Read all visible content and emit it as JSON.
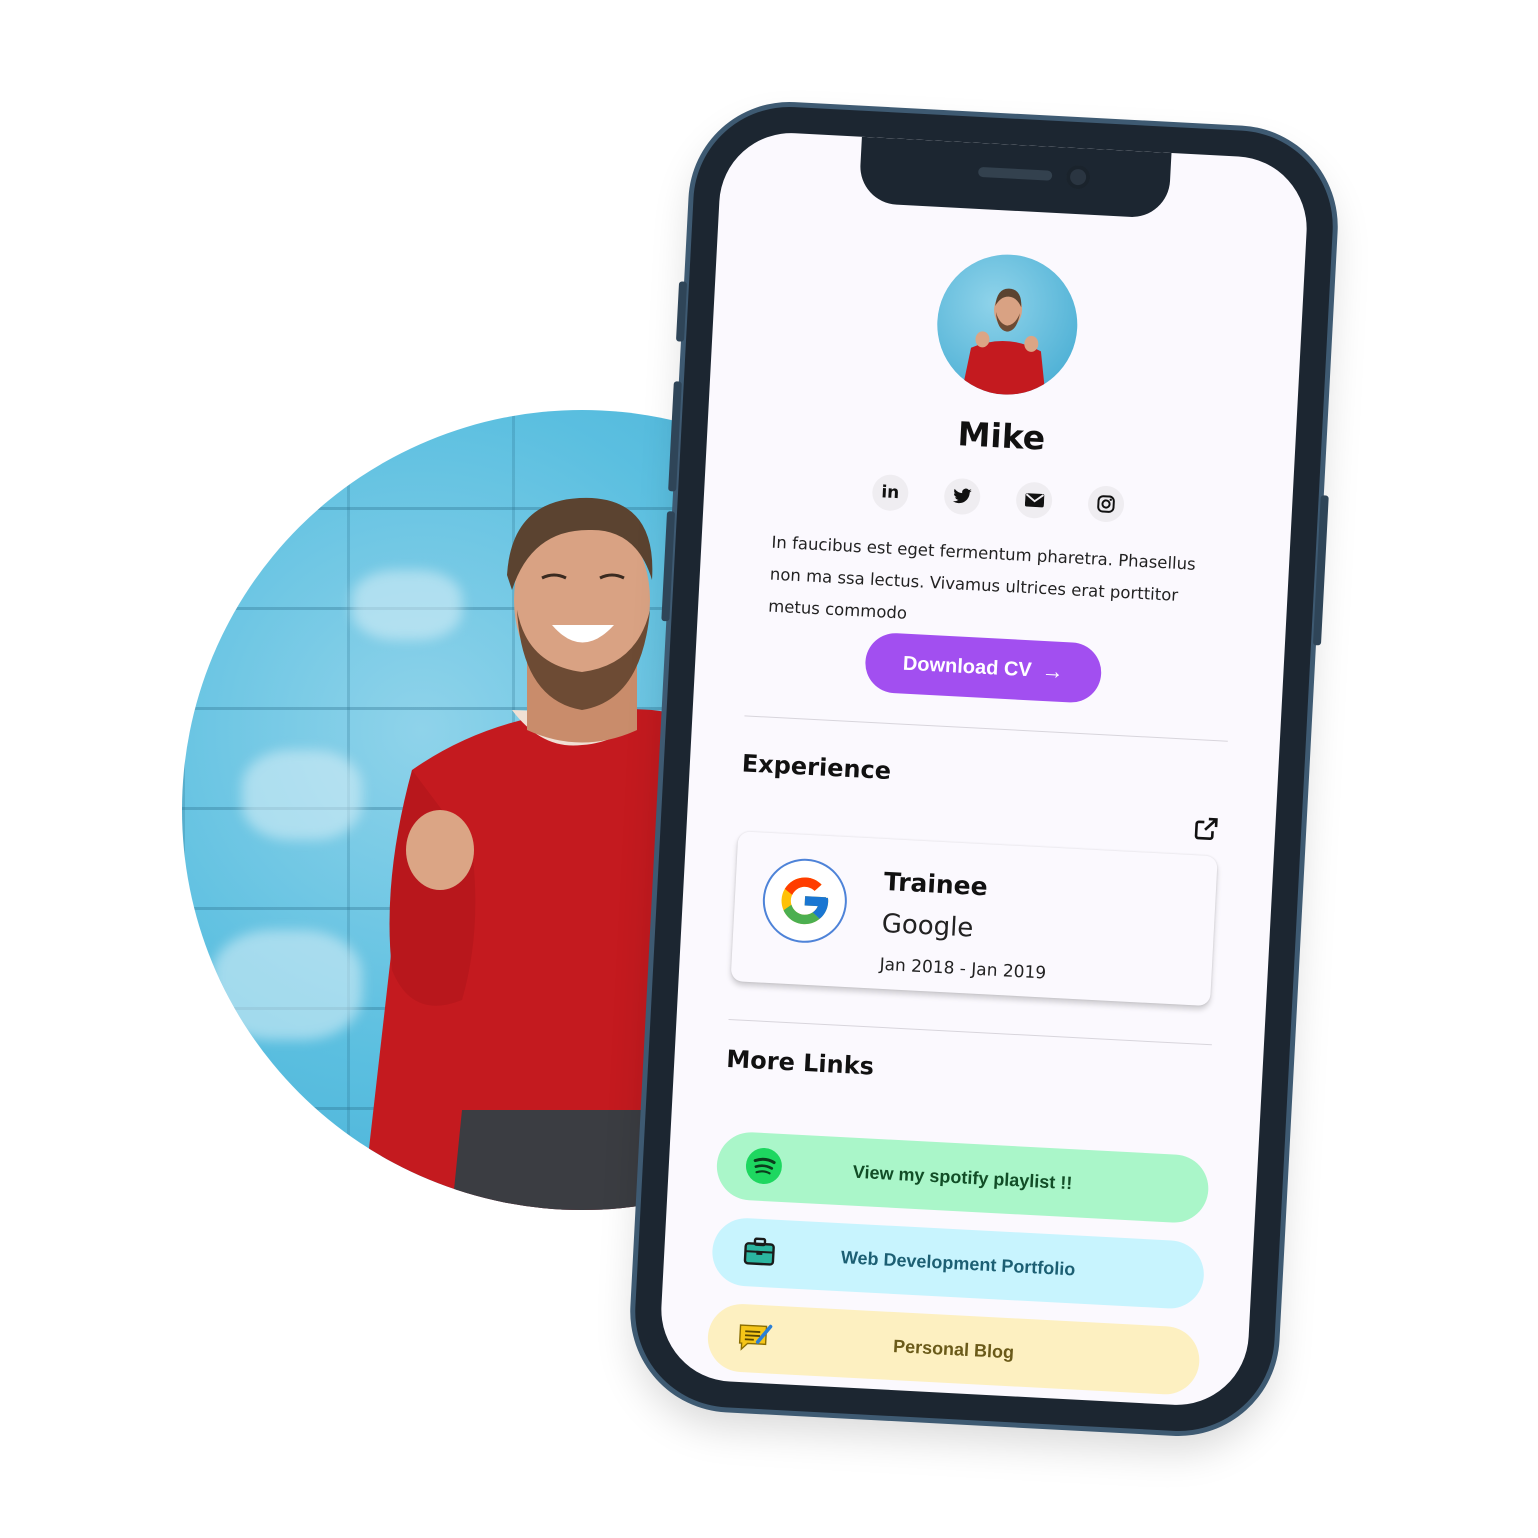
{
  "profile": {
    "name": "Mike",
    "bio": "In faucibus est eget fermentum pharetra. Phasellus non ma ssa lectus. Vivamus ultrices erat porttitor metus commodo"
  },
  "socials": [
    {
      "icon": "linkedin-icon",
      "glyph": "in"
    },
    {
      "icon": "twitter-icon",
      "glyph": ""
    },
    {
      "icon": "mail-icon",
      "glyph": ""
    },
    {
      "icon": "instagram-icon",
      "glyph": ""
    }
  ],
  "cta": {
    "label": "Download CV",
    "arrow": "→"
  },
  "experience": {
    "title": "Experience",
    "items": [
      {
        "role": "Trainee",
        "company": "Google",
        "period": "Jan 2018 - Jan 2019",
        "logo": "google-logo-icon"
      }
    ]
  },
  "more_links": {
    "title": "More Links",
    "items": [
      {
        "label": "View my spotify playlist !!",
        "icon": "spotify-icon",
        "color": "#aaf6c9"
      },
      {
        "label": "Web Development Portfolio",
        "icon": "briefcase-icon",
        "color": "#c8f4fe"
      },
      {
        "label": "Personal Blog",
        "icon": "blog-icon",
        "color": "#fdf0c1"
      }
    ]
  },
  "colors": {
    "accent": "#a24ff0",
    "screen_bg": "#fbf9fe",
    "phone_frame": "#1c2631"
  }
}
